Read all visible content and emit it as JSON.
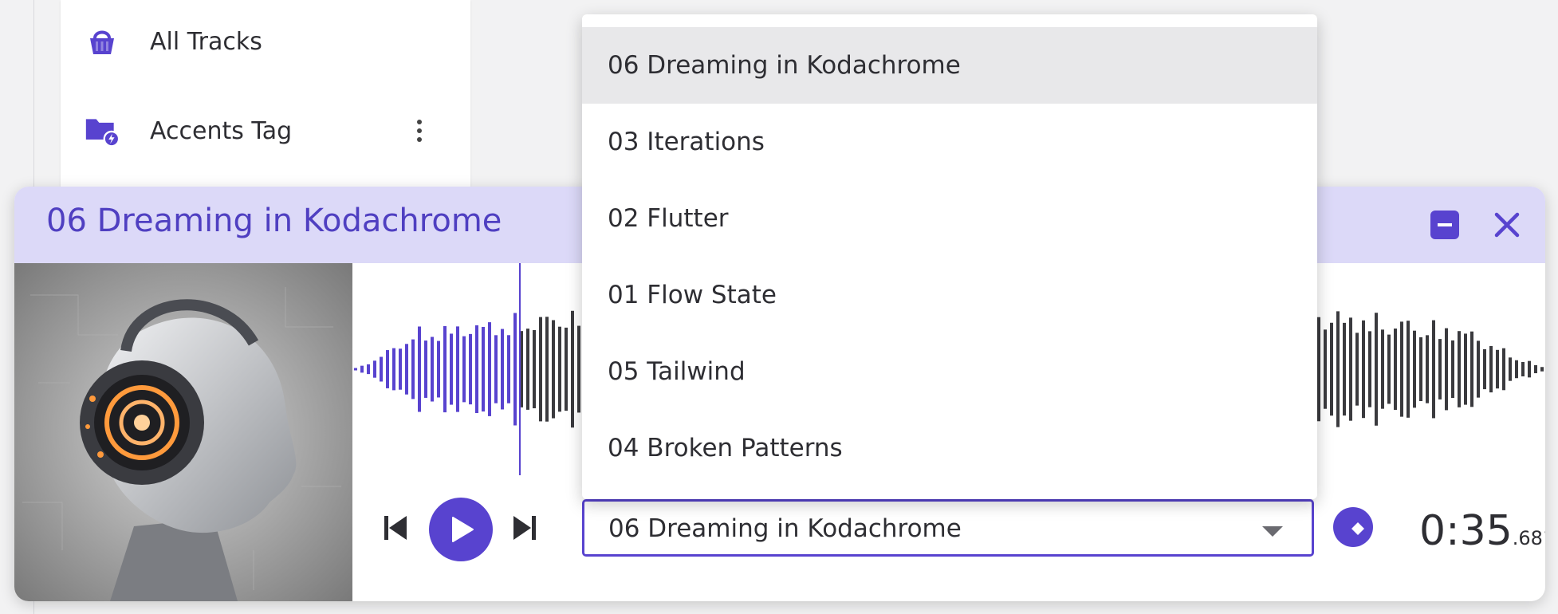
{
  "sidebar": {
    "items": [
      {
        "label": "All Tracks",
        "icon": "basket-icon"
      },
      {
        "label": "Accents Tag",
        "icon": "folder-bolt-icon",
        "has_menu": true
      }
    ]
  },
  "player": {
    "title": "06 Dreaming in Kodachrome",
    "minimize_icon": "minimize-icon",
    "close_icon": "close-icon",
    "accent_color": "#5843cf",
    "header_color": "#dcd9f8",
    "progress_fraction": 0.14
  },
  "track_select": {
    "selected": "06 Dreaming in Kodachrome",
    "options": [
      "06 Dreaming in Kodachrome",
      "03 Iterations",
      "02 Flutter",
      "01 Flow State",
      "05 Tailwind",
      "04 Broken Patterns"
    ]
  },
  "time": {
    "main": "0:35",
    "ms": ".681"
  }
}
